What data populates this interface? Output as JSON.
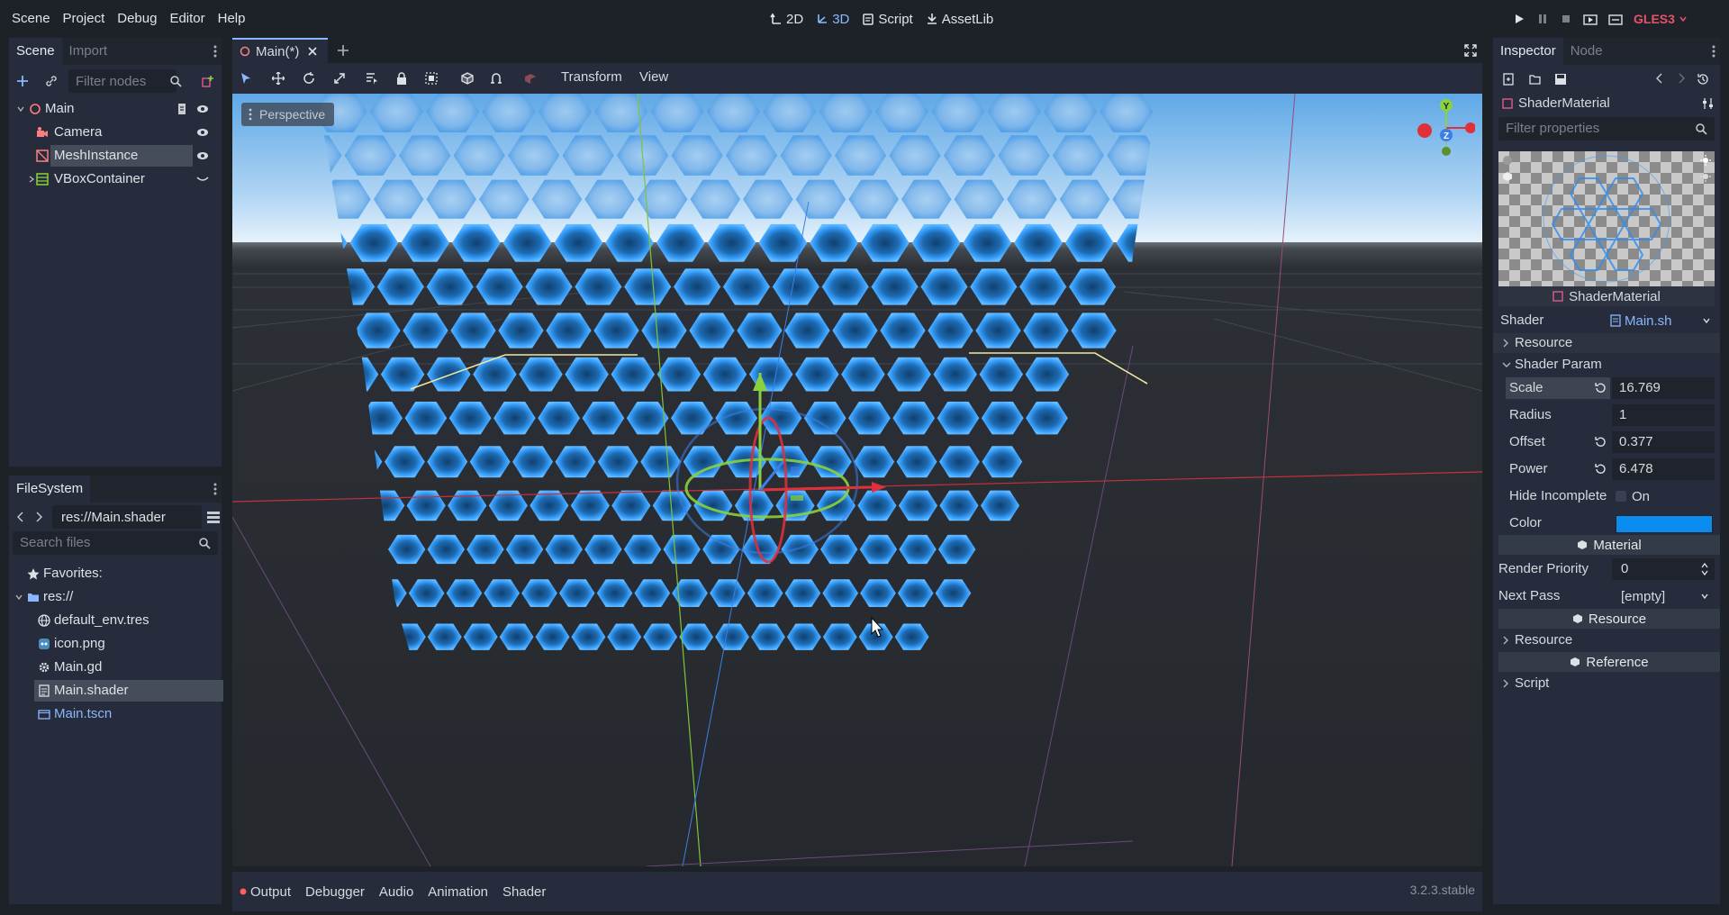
{
  "menus": [
    "Scene",
    "Project",
    "Debug",
    "Editor",
    "Help"
  ],
  "workspaces": [
    {
      "label": "2D",
      "icon": "2d-icon",
      "active": false
    },
    {
      "label": "3D",
      "icon": "3d-icon",
      "active": true
    },
    {
      "label": "Script",
      "icon": "script-icon",
      "active": false
    },
    {
      "label": "AssetLib",
      "icon": "assetlib-icon",
      "active": false
    }
  ],
  "renderer": "GLES3",
  "scene_dock": {
    "tabs": [
      "Scene",
      "Import"
    ],
    "filter_placeholder": "Filter nodes",
    "nodes": [
      {
        "name": "Main",
        "icon": "node-spatial-icon"
      },
      {
        "name": "Camera",
        "icon": "camera-icon"
      },
      {
        "name": "MeshInstance",
        "icon": "mesh-instance-icon",
        "selected": true
      },
      {
        "name": "VBoxContainer",
        "icon": "vbox-icon"
      }
    ]
  },
  "filesystem": {
    "tab": "FileSystem",
    "path": "res://Main.shader",
    "search_placeholder": "Search files",
    "favorites_label": "Favorites:",
    "root": "res://",
    "files": [
      {
        "name": "default_env.tres",
        "icon": "environment-icon"
      },
      {
        "name": "icon.png",
        "icon": "image-icon"
      },
      {
        "name": "Main.gd",
        "icon": "gear-icon"
      },
      {
        "name": "Main.shader",
        "icon": "shader-file-icon",
        "selected": true
      },
      {
        "name": "Main.tscn",
        "icon": "scene-file-icon",
        "highlight": true
      }
    ]
  },
  "editor_tabs": [
    {
      "label": "Main(*)"
    }
  ],
  "viewport_toolbar": {
    "transform": "Transform",
    "view": "View"
  },
  "viewport": {
    "label": "Perspective",
    "gizmo_axes": [
      "Y",
      "Z"
    ]
  },
  "bottom_panel": {
    "tabs": [
      "Output",
      "Debugger",
      "Audio",
      "Animation",
      "Shader"
    ],
    "version": "3.2.3.stable"
  },
  "inspector": {
    "tabs": [
      "Inspector",
      "Node"
    ],
    "resource_name": "ShaderMaterial",
    "filter_placeholder": "Filter properties",
    "preview_label": "ShaderMaterial",
    "shader_label": "Shader",
    "shader_value": "Main.sh",
    "resource_sub": "Resource",
    "shader_param_label": "Shader Param",
    "params": [
      {
        "label": "Scale",
        "value": "16.769",
        "revert": true
      },
      {
        "label": "Radius",
        "value": "1",
        "revert": false
      },
      {
        "label": "Offset",
        "value": "0.377",
        "revert": true
      },
      {
        "label": "Power",
        "value": "6.478",
        "revert": true
      }
    ],
    "hide_incomplete_label": "Hide Incomplete",
    "hide_incomplete_value": "On",
    "color_label": "Color",
    "color_value": "#0a8cf0",
    "material_section": "Material",
    "render_priority_label": "Render Priority",
    "render_priority_value": "0",
    "next_pass_label": "Next Pass",
    "next_pass_value": "[empty]",
    "resource_section": "Resource",
    "resource_item": "Resource",
    "reference_section": "Reference",
    "script_item": "Script"
  },
  "colors": {
    "accent": "#8ab7ff",
    "hex_glow": "#2e9bff",
    "x_axis": "#e0303c",
    "y_axis": "#8ad13c",
    "z_axis": "#3a7fe8"
  }
}
